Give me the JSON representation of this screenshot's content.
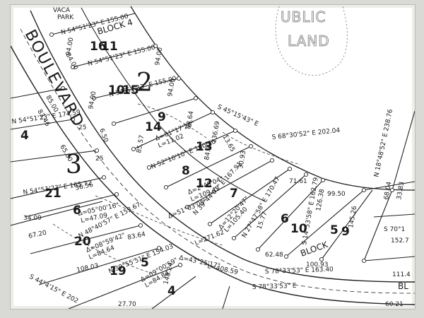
{
  "map": {
    "street_name": "BOULEVARD",
    "public_land": [
      "UBLIC",
      "LAND"
    ],
    "block_labels": [
      "BLOCK 4",
      "BLOCK"
    ],
    "block_numbers": [
      "2",
      "3"
    ],
    "lot_numbers": [
      "16",
      "11",
      "10",
      "15",
      "14",
      "9",
      "13",
      "8",
      "12",
      "7",
      "6",
      "5",
      "4",
      "21",
      "6",
      "20",
      "19",
      "5",
      "4",
      "10",
      "9"
    ],
    "bearings": [
      "N 54°51'23\" E 155.00",
      "N 54°51'23\" E 155.00",
      "N 54°51'23\" E 155.00",
      "N 54°51'23\" E 174.59",
      "N 54°51'23\" E 165.72",
      "S 45°15'43\" E",
      "S 68°30'52\" E 202.04",
      "N 18°48'52\" E 238.76",
      "N 52°10'10\" E 160.20",
      "N 39°44'01\" E 167.91",
      "N 27°47'58\" E 170.47",
      "S 14°53'58\" E 162.79",
      "N 48°40'57\" E 153.67",
      "N 39°55'51\" E 154.03",
      "S 78°33'53\" E 163.40",
      "S 78°33'53\" E",
      "S 44°4'15\" E 202",
      "S 70°1"
    ],
    "curve_data": [
      "Δ=01°17'26\"",
      "L=11.02",
      "Δ=2°49'04\"",
      "L=109.43",
      "Δ=12°20'47\"",
      "L=105.40",
      "Δ=05°00'16\"",
      "L=47.09",
      "Δ=08°59'42\"",
      "L=84.64",
      "Δ=09°00'59\"",
      "L=84.84",
      "Δ=43°25'17\"",
      "L=408.59",
      "Δ=51°03'05\"",
      "L=271.62"
    ],
    "distances": [
      "94.00",
      "94.00",
      "94.00",
      "94.00",
      "84.00",
      "85.00",
      "65.00",
      "136.69",
      "13.65",
      "30.93",
      "99.50",
      "68.04",
      "33.83",
      "83.64",
      "36.56",
      "34.09",
      "67.20",
      "108.03",
      "62.48",
      "100.93",
      "145.26",
      "152.7",
      "111.4",
      "60.21",
      "27.70",
      "71.61",
      "88.64",
      "84.82",
      "85.57",
      "25",
      "25",
      "6.50",
      "83.46",
      "126.38",
      "15.77",
      "148.24"
    ],
    "tokens": [
      "VACA",
      "PARK",
      "BL"
    ]
  }
}
